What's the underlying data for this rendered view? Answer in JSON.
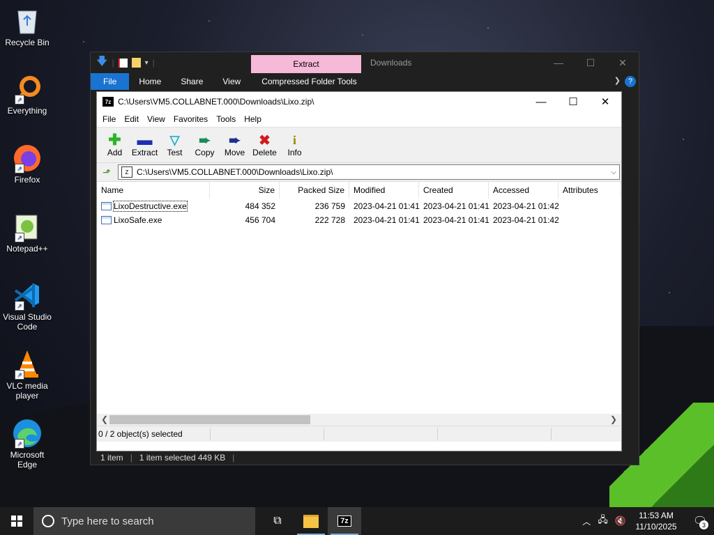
{
  "desktop": {
    "icons": [
      {
        "label": "Recycle Bin"
      },
      {
        "label": "Everything"
      },
      {
        "label": "Firefox"
      },
      {
        "label": "Notepad++"
      },
      {
        "label": "Visual Studio Code"
      },
      {
        "label": "VLC media player"
      },
      {
        "label": "Microsoft Edge"
      }
    ]
  },
  "explorer": {
    "context_tab": "Extract",
    "title": "Downloads",
    "ribbon": {
      "file": "File",
      "home": "Home",
      "share": "Share",
      "view": "View",
      "tools": "Compressed Folder Tools"
    },
    "status": {
      "items": "1 item",
      "selected": "1 item selected  449 KB"
    }
  },
  "sevenzip": {
    "title": "C:\\Users\\VM5.COLLABNET.000\\Downloads\\Lixo.zip\\",
    "menu": [
      "File",
      "Edit",
      "View",
      "Favorites",
      "Tools",
      "Help"
    ],
    "toolbar": [
      {
        "label": "Add",
        "icon": "add-icon"
      },
      {
        "label": "Extract",
        "icon": "extract-icon"
      },
      {
        "label": "Test",
        "icon": "test-icon"
      },
      {
        "label": "Copy",
        "icon": "copy-icon"
      },
      {
        "label": "Move",
        "icon": "move-icon"
      },
      {
        "label": "Delete",
        "icon": "delete-icon"
      },
      {
        "label": "Info",
        "icon": "info-icon"
      }
    ],
    "address": "C:\\Users\\VM5.COLLABNET.000\\Downloads\\Lixo.zip\\",
    "columns": [
      "Name",
      "Size",
      "Packed Size",
      "Modified",
      "Created",
      "Accessed",
      "Attributes"
    ],
    "files": [
      {
        "name": "LixoDestructive.exe",
        "size": "484 352",
        "packed": "236 759",
        "modified": "2023-04-21 01:41",
        "created": "2023-04-21 01:41",
        "accessed": "2023-04-21 01:42"
      },
      {
        "name": "LixoSafe.exe",
        "size": "456 704",
        "packed": "222 728",
        "modified": "2023-04-21 01:41",
        "created": "2023-04-21 01:41",
        "accessed": "2023-04-21 01:42"
      }
    ],
    "status": "0 / 2 object(s) selected"
  },
  "taskbar": {
    "search_placeholder": "Type here to search",
    "time": "11:53 AM",
    "date": "11/10/2025",
    "notifications": "3"
  }
}
